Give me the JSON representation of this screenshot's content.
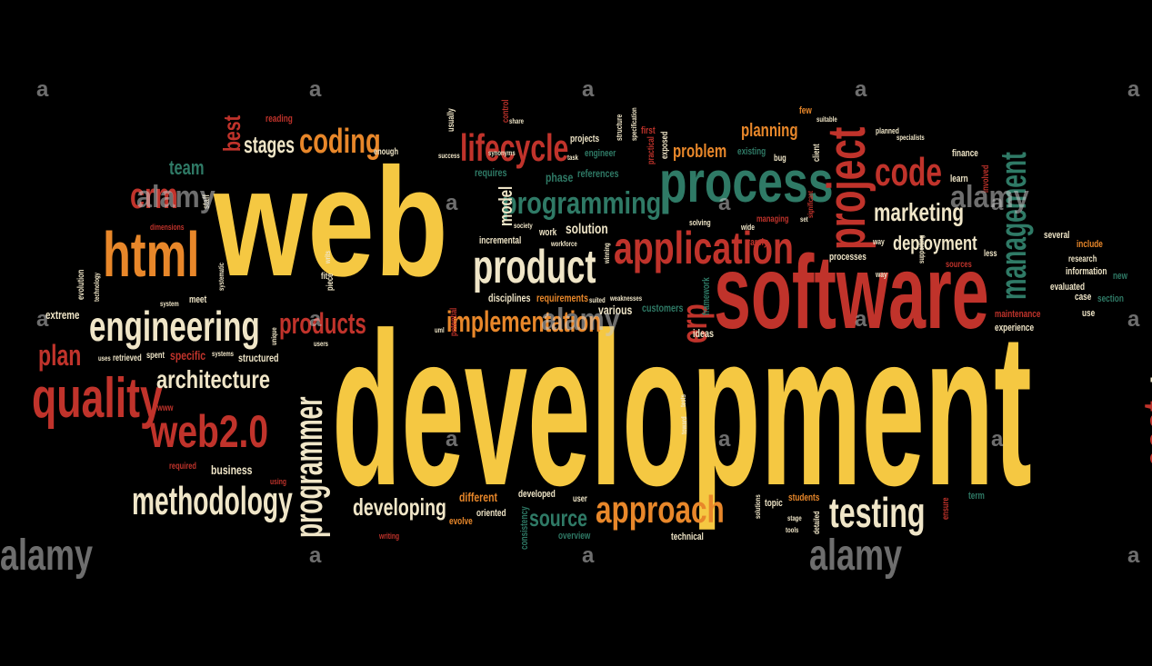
{
  "palette": {
    "yellow": "#f5c842",
    "orange": "#e8872a",
    "red": "#c0332b",
    "teal": "#2f7a66",
    "cream": "#f0e6c8",
    "background": "#000000"
  },
  "words": [
    {
      "text": "web",
      "color": "yellow"
    },
    {
      "text": "development",
      "color": "yellow"
    },
    {
      "text": "software",
      "color": "red"
    },
    {
      "text": "process",
      "color": "teal"
    },
    {
      "text": "html",
      "color": "orange"
    },
    {
      "text": "engineering",
      "color": "cream"
    },
    {
      "text": "quality",
      "color": "red"
    },
    {
      "text": "web2.0",
      "color": "red"
    },
    {
      "text": "methodology",
      "color": "cream"
    },
    {
      "text": "architecture",
      "color": "cream"
    },
    {
      "text": "programmer",
      "color": "cream"
    },
    {
      "text": "product",
      "color": "cream"
    },
    {
      "text": "application",
      "color": "red"
    },
    {
      "text": "programming",
      "color": "teal"
    },
    {
      "text": "lifecycle",
      "color": "red"
    },
    {
      "text": "coding",
      "color": "orange"
    },
    {
      "text": "stages",
      "color": "cream"
    },
    {
      "text": "project",
      "color": "red"
    },
    {
      "text": "code",
      "color": "red"
    },
    {
      "text": "marketing",
      "color": "cream"
    },
    {
      "text": "deployment",
      "color": "cream"
    },
    {
      "text": "management",
      "color": "teal"
    },
    {
      "text": "testing",
      "color": "cream"
    },
    {
      "text": "approach",
      "color": "orange"
    },
    {
      "text": "developing",
      "color": "cream"
    },
    {
      "text": "source",
      "color": "teal"
    },
    {
      "text": "implementation",
      "color": "orange"
    },
    {
      "text": "products",
      "color": "red"
    },
    {
      "text": "time",
      "color": "cream"
    },
    {
      "text": "cost",
      "color": "red"
    },
    {
      "text": "erp",
      "color": "red"
    },
    {
      "text": "crm",
      "color": "red"
    },
    {
      "text": "team",
      "color": "teal"
    },
    {
      "text": "plan",
      "color": "red"
    },
    {
      "text": "best",
      "color": "red"
    },
    {
      "text": "planning",
      "color": "orange"
    },
    {
      "text": "problem",
      "color": "orange"
    },
    {
      "text": "model",
      "color": "cream"
    },
    {
      "text": "solution",
      "color": "cream"
    },
    {
      "text": "different",
      "color": "orange"
    },
    {
      "text": "business",
      "color": "cream"
    },
    {
      "text": "specific",
      "color": "red"
    },
    {
      "text": "extreme",
      "color": "cream"
    },
    {
      "text": "structured",
      "color": "cream"
    },
    {
      "text": "retrieved",
      "color": "cream"
    },
    {
      "text": "spent",
      "color": "cream"
    },
    {
      "text": "various",
      "color": "cream"
    },
    {
      "text": "customers",
      "color": "teal"
    },
    {
      "text": "requirements",
      "color": "orange"
    },
    {
      "text": "disciplines",
      "color": "cream"
    },
    {
      "text": "phase",
      "color": "teal"
    },
    {
      "text": "references",
      "color": "teal"
    },
    {
      "text": "requires",
      "color": "teal"
    },
    {
      "text": "incremental",
      "color": "cream"
    },
    {
      "text": "work",
      "color": "cream"
    },
    {
      "text": "engineer",
      "color": "teal"
    },
    {
      "text": "projects",
      "color": "cream"
    },
    {
      "text": "ideas",
      "color": "cream"
    },
    {
      "text": "framework",
      "color": "teal"
    },
    {
      "text": "experience",
      "color": "cream"
    },
    {
      "text": "maintenance",
      "color": "red"
    },
    {
      "text": "evaluated",
      "color": "cream"
    },
    {
      "text": "case",
      "color": "cream"
    },
    {
      "text": "section",
      "color": "teal"
    },
    {
      "text": "information",
      "color": "cream"
    },
    {
      "text": "research",
      "color": "cream"
    },
    {
      "text": "include",
      "color": "orange"
    },
    {
      "text": "several",
      "color": "cream"
    },
    {
      "text": "processes",
      "color": "cream"
    },
    {
      "text": "finance",
      "color": "cream"
    },
    {
      "text": "learn",
      "color": "cream"
    },
    {
      "text": "existing",
      "color": "teal"
    },
    {
      "text": "managing",
      "color": "red"
    },
    {
      "text": "rarely",
      "color": "red"
    },
    {
      "text": "developed",
      "color": "cream"
    },
    {
      "text": "oriented",
      "color": "cream"
    },
    {
      "text": "evolve",
      "color": "orange"
    },
    {
      "text": "user",
      "color": "cream"
    },
    {
      "text": "overview",
      "color": "teal"
    },
    {
      "text": "technical",
      "color": "cream"
    },
    {
      "text": "students",
      "color": "orange"
    },
    {
      "text": "topic",
      "color": "cream"
    },
    {
      "text": "term",
      "color": "teal"
    },
    {
      "text": "consistency",
      "color": "teal"
    },
    {
      "text": "meet",
      "color": "cream"
    },
    {
      "text": "few",
      "color": "orange"
    },
    {
      "text": "enough",
      "color": "cream"
    },
    {
      "text": "reading",
      "color": "red"
    },
    {
      "text": "usually",
      "color": "cream"
    },
    {
      "text": "control",
      "color": "red"
    },
    {
      "text": "first",
      "color": "red"
    },
    {
      "text": "exposed",
      "color": "cream"
    },
    {
      "text": "practical",
      "color": "red"
    },
    {
      "text": "client",
      "color": "cream"
    },
    {
      "text": "bug",
      "color": "cream"
    },
    {
      "text": "use",
      "color": "cream"
    },
    {
      "text": "new",
      "color": "teal"
    },
    {
      "text": "less",
      "color": "cream"
    },
    {
      "text": "sources",
      "color": "red"
    },
    {
      "text": "ensure",
      "color": "red"
    },
    {
      "text": "piece",
      "color": "cream"
    },
    {
      "text": "fit",
      "color": "cream"
    },
    {
      "text": "evolution",
      "color": "cream"
    },
    {
      "text": "potential",
      "color": "red"
    },
    {
      "text": "www",
      "color": "red"
    },
    {
      "text": "required",
      "color": "red"
    },
    {
      "text": "using",
      "color": "red"
    },
    {
      "text": "writing",
      "color": "red"
    },
    {
      "text": "staff",
      "color": "cream"
    },
    {
      "text": "dimensions",
      "color": "red"
    },
    {
      "text": "way",
      "color": "cream"
    },
    {
      "text": "way",
      "color": "cream"
    },
    {
      "text": "solving",
      "color": "cream"
    },
    {
      "text": "wide",
      "color": "cream"
    },
    {
      "text": "planned",
      "color": "cream"
    },
    {
      "text": "specialists",
      "color": "cream"
    },
    {
      "text": "suitable",
      "color": "cream"
    },
    {
      "text": "success",
      "color": "cream"
    },
    {
      "text": "synonyms",
      "color": "cream"
    },
    {
      "text": "society",
      "color": "cream"
    },
    {
      "text": "workforce",
      "color": "cream"
    },
    {
      "text": "winning",
      "color": "cream"
    },
    {
      "text": "suited",
      "color": "cream"
    },
    {
      "text": "weaknesses",
      "color": "cream"
    },
    {
      "text": "share",
      "color": "cream"
    },
    {
      "text": "task",
      "color": "cream"
    },
    {
      "text": "specification",
      "color": "cream"
    },
    {
      "text": "structure",
      "color": "cream"
    },
    {
      "text": "uml",
      "color": "cream"
    },
    {
      "text": "users",
      "color": "cream"
    },
    {
      "text": "uses",
      "color": "cream"
    },
    {
      "text": "systems",
      "color": "cream"
    },
    {
      "text": "systematic",
      "color": "cream"
    },
    {
      "text": "system",
      "color": "cream"
    },
    {
      "text": "technology",
      "color": "cream"
    },
    {
      "text": "significant",
      "color": "red"
    },
    {
      "text": "set",
      "color": "cream"
    },
    {
      "text": "tools",
      "color": "cream"
    },
    {
      "text": "stage",
      "color": "cream"
    },
    {
      "text": "solutions",
      "color": "cream"
    },
    {
      "text": "detailed",
      "color": "cream"
    },
    {
      "text": "toward",
      "color": "cream"
    },
    {
      "text": "tests",
      "color": "cream"
    },
    {
      "text": "unique",
      "color": "cream"
    },
    {
      "text": "writs",
      "color": "cream"
    },
    {
      "text": "supporting",
      "color": "cream"
    },
    {
      "text": "involved",
      "color": "red"
    }
  ],
  "watermarks": [
    {
      "text": "a"
    },
    {
      "text": "a"
    },
    {
      "text": "a"
    },
    {
      "text": "a"
    },
    {
      "text": "a"
    },
    {
      "text": "alamy"
    },
    {
      "text": "alamy"
    },
    {
      "text": "alamy"
    },
    {
      "text": "alamy"
    },
    {
      "text": "a"
    },
    {
      "text": "a"
    },
    {
      "text": "a"
    },
    {
      "text": "a"
    },
    {
      "text": "a"
    },
    {
      "text": "a"
    },
    {
      "text": "a"
    },
    {
      "text": "a"
    },
    {
      "text": "a"
    },
    {
      "text": "alamy"
    },
    {
      "text": "alamy"
    },
    {
      "text": "a"
    },
    {
      "text": "a"
    },
    {
      "text": "a"
    },
    {
      "text": "a"
    },
    {
      "text": "a"
    }
  ]
}
